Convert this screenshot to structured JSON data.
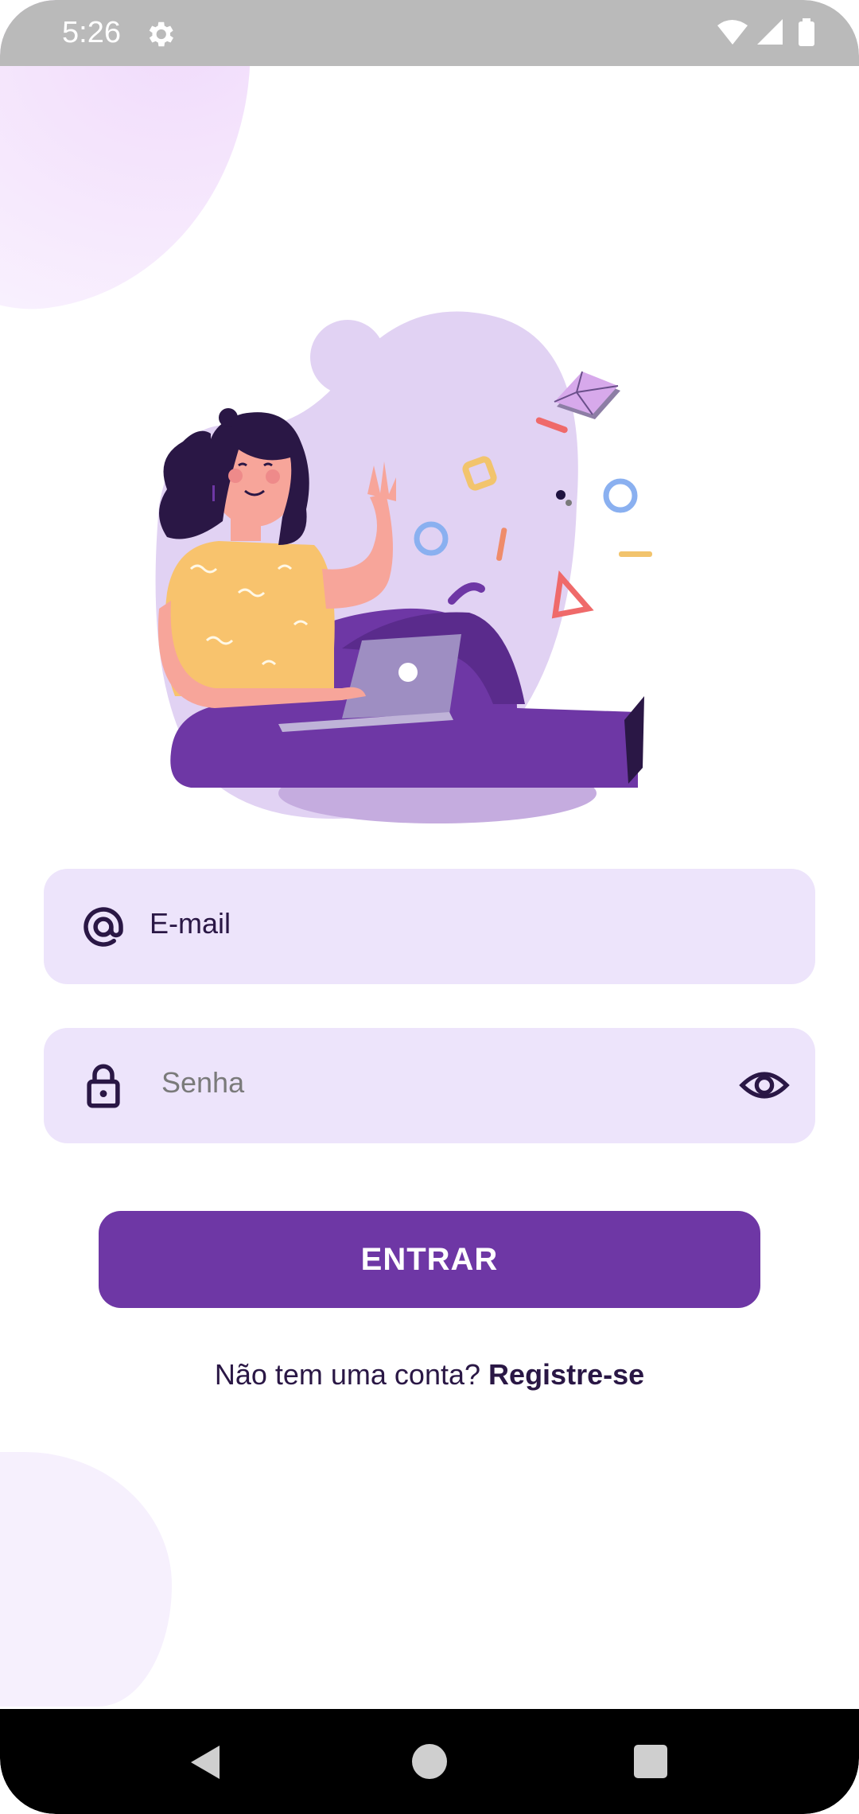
{
  "status_bar": {
    "time": "5:26",
    "icons": [
      "gear-icon",
      "wifi-icon",
      "signal-icon",
      "battery-icon"
    ]
  },
  "login": {
    "email_placeholder": "E-mail",
    "password_placeholder": "Senha",
    "submit_label": "ENTRAR",
    "register_prompt": "Não tem uma conta?",
    "register_link": "Registre-se"
  },
  "colors": {
    "primary": "#6e37a5",
    "field_bg": "#ede4fb",
    "text_dark": "#2a1745"
  },
  "nav_bar": {
    "icons": [
      "back-icon",
      "home-icon",
      "recents-icon"
    ]
  }
}
